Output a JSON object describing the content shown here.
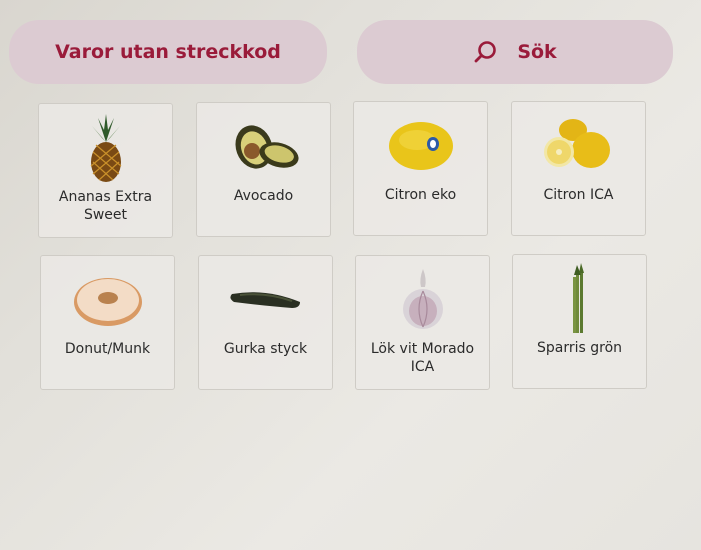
{
  "buttons": {
    "no_barcode_label": "Varor utan streckkod",
    "search_label": "Sök"
  },
  "products": [
    {
      "label": "Ananas Extra Sweet",
      "icon": "pineapple-icon"
    },
    {
      "label": "Avocado",
      "icon": "avocado-icon"
    },
    {
      "label": "Citron eko",
      "icon": "lemon-icon"
    },
    {
      "label": "Citron ICA",
      "icon": "lemons-icon"
    },
    {
      "label": "Donut/Munk",
      "icon": "donut-icon"
    },
    {
      "label": "Gurka styck",
      "icon": "cucumber-icon"
    },
    {
      "label": "Lök vit Morado ICA",
      "icon": "garlic-icon"
    },
    {
      "label": "Sparris grön",
      "icon": "asparagus-icon"
    }
  ],
  "colors": {
    "accent": "#9a1b3a",
    "button_bg": "#dccbd2",
    "background": "#e6e4df"
  }
}
